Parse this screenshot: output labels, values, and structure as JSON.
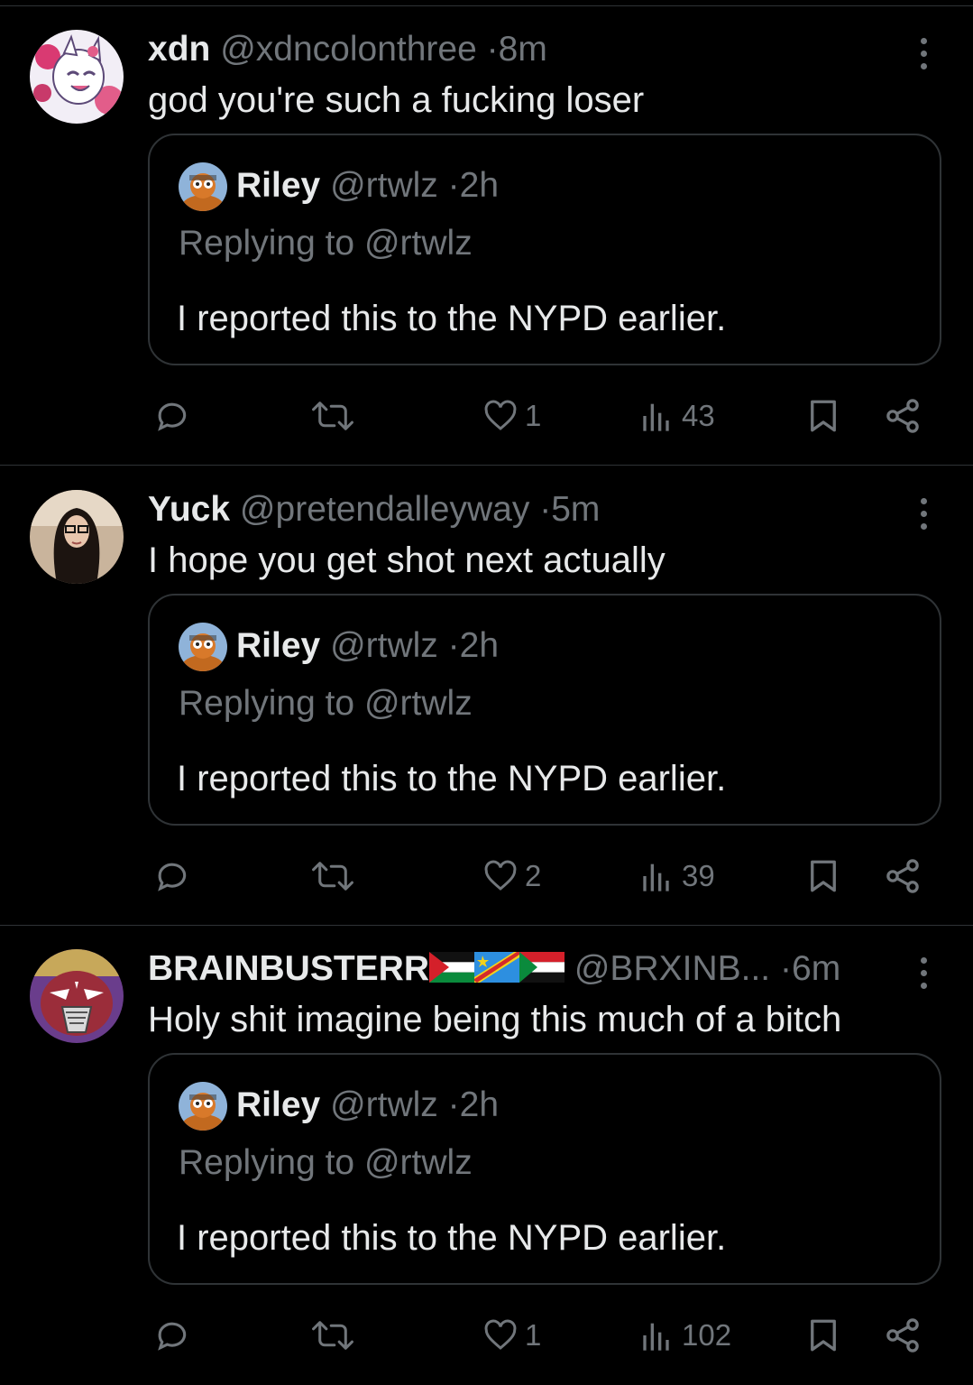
{
  "posts": [
    {
      "name": "xdn",
      "handle": "@xdncolonthree",
      "time": "8m",
      "text": "god you're such a fucking loser",
      "flags": [],
      "quote": {
        "name": "Riley",
        "handle": "@rtwlz",
        "time": "2h",
        "replying": "Replying to @rtwlz",
        "text": "I reported this to the NYPD earlier."
      },
      "likes": "1",
      "views": "43"
    },
    {
      "name": "Yuck",
      "handle": "@pretendalleyway",
      "time": "5m",
      "text": "I hope you get shot next actually",
      "flags": [],
      "quote": {
        "name": "Riley",
        "handle": "@rtwlz",
        "time": "2h",
        "replying": "Replying to @rtwlz",
        "text": "I reported this to the NYPD earlier."
      },
      "likes": "2",
      "views": "39"
    },
    {
      "name": "BRAINBUSTERR",
      "handle": "@BRXINB...",
      "time": "6m",
      "text": "Holy shit imagine being this much of a bitch",
      "flags": [
        "palestine-flag",
        "dr-congo-flag",
        "sudan-flag"
      ],
      "quote": {
        "name": "Riley",
        "handle": "@rtwlz",
        "time": "2h",
        "replying": "Replying to @rtwlz",
        "text": "I reported this to the NYPD earlier."
      },
      "likes": "1",
      "views": "102"
    }
  ],
  "separator": "·",
  "icons": [
    "more-icon",
    "reply-icon",
    "retweet-icon",
    "like-icon",
    "views-icon",
    "bookmark-icon",
    "share-icon"
  ],
  "colors": {
    "background": "#000000",
    "text": "#e7e9ea",
    "muted": "#71767b",
    "border": "#2f3336"
  }
}
